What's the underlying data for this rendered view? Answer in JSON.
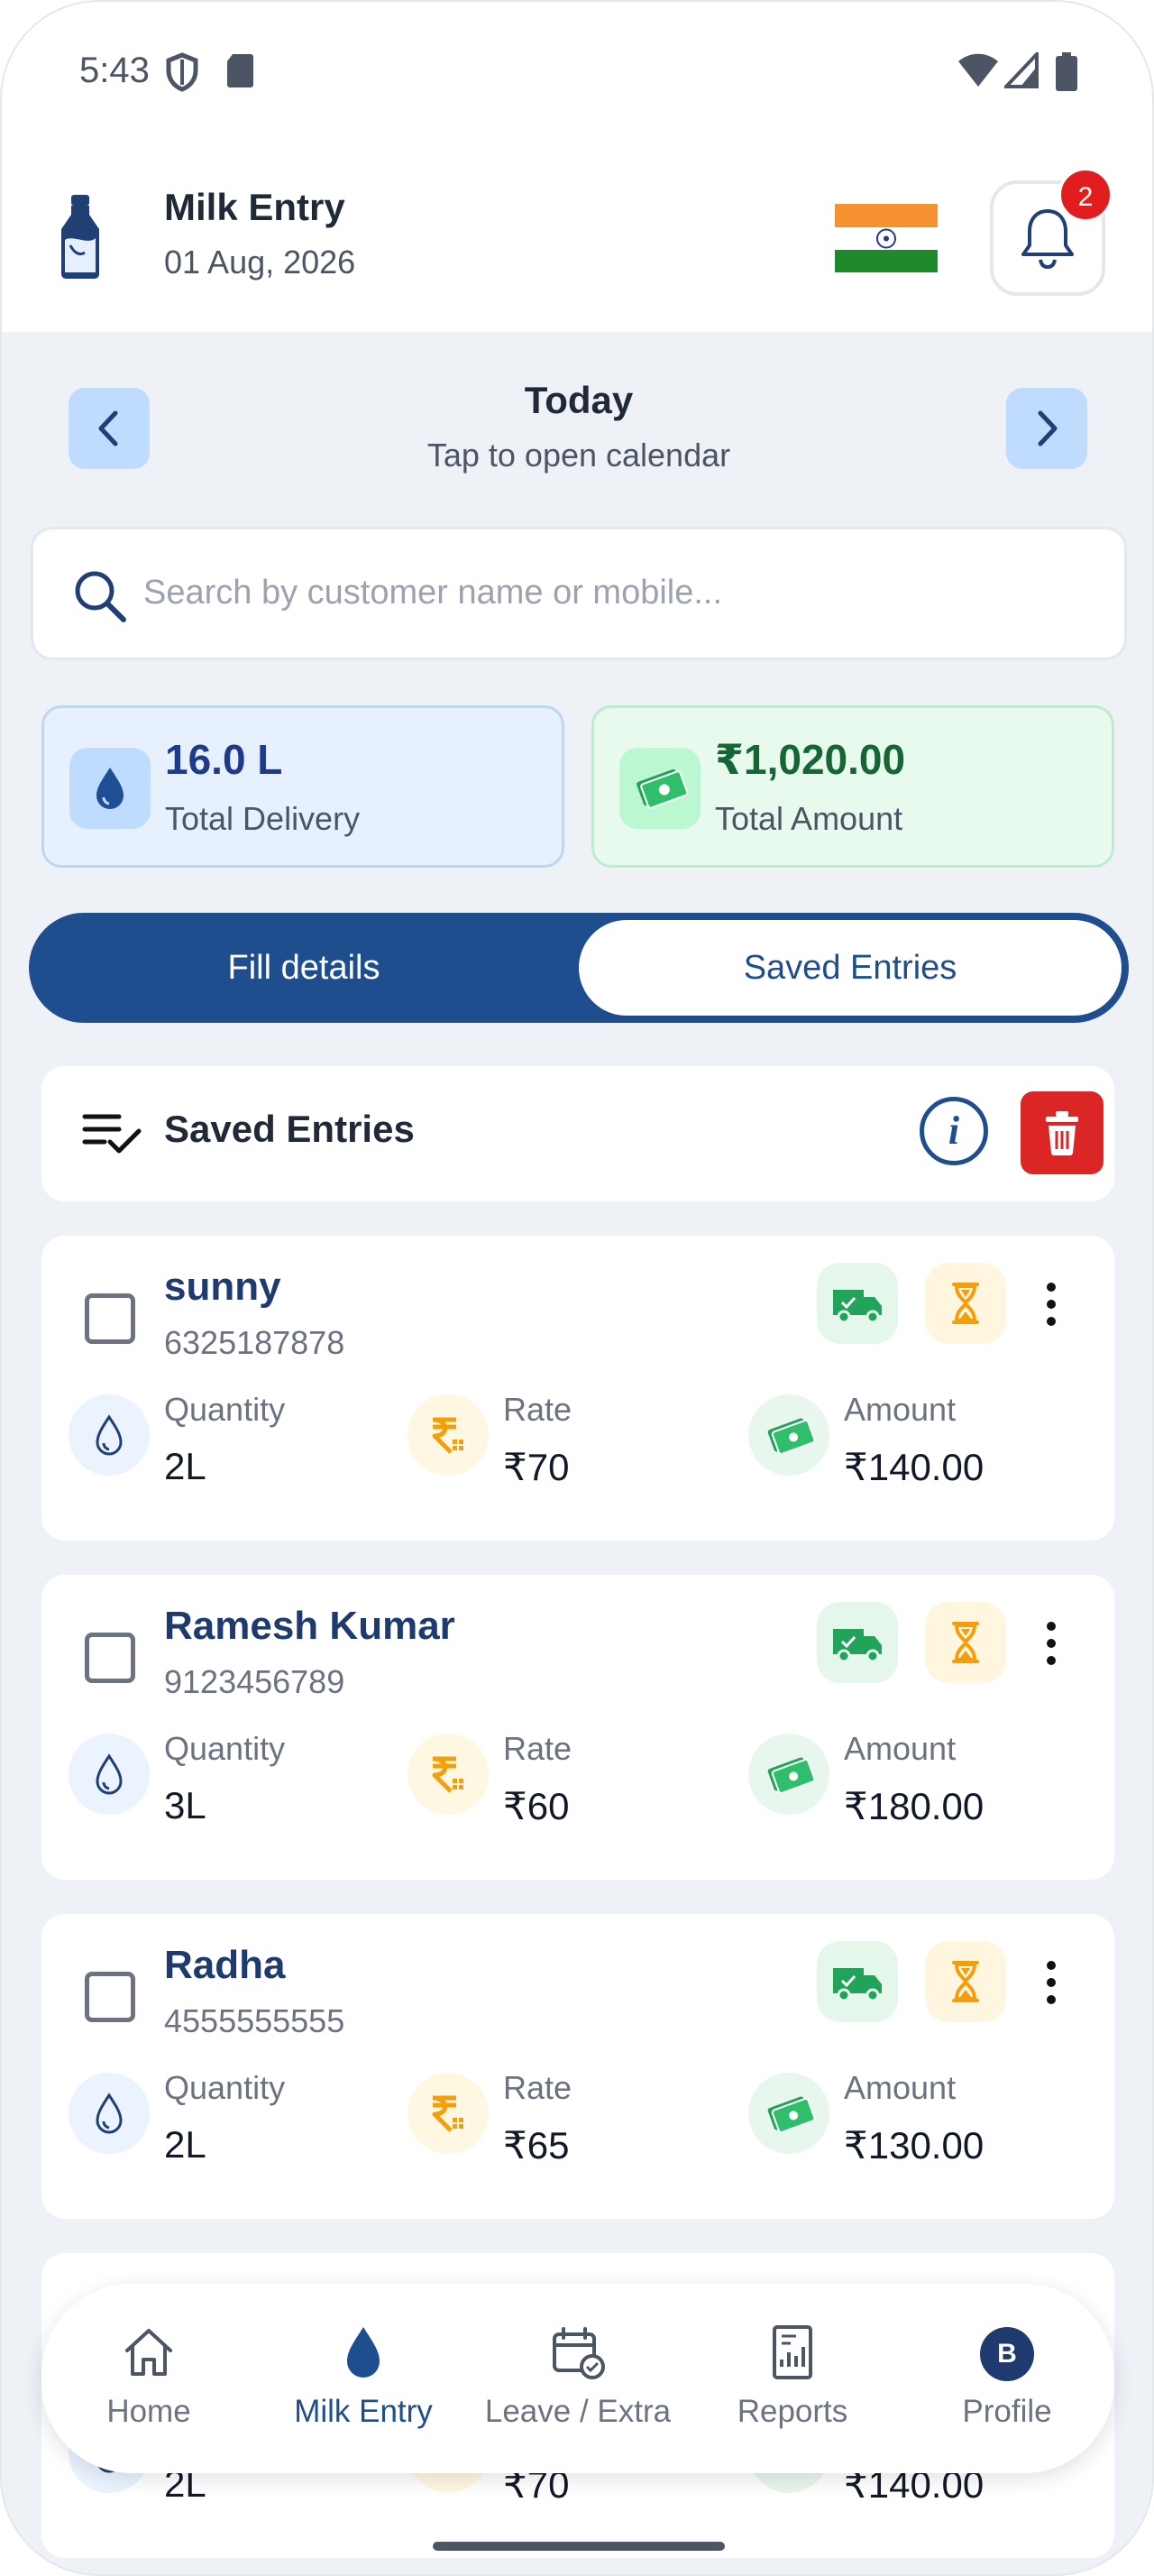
{
  "status_bar": {
    "time": "5:43"
  },
  "header": {
    "title": "Milk Entry",
    "date": "01 Aug, 2026",
    "notification_count": "2"
  },
  "date_nav": {
    "title": "Today",
    "subtitle": "Tap to open calendar"
  },
  "search": {
    "placeholder": "Search by customer name or mobile...",
    "value": ""
  },
  "stats": {
    "delivery_value": "16.0 L",
    "delivery_label": "Total Delivery",
    "amount_value": "₹1,020.00",
    "amount_label": "Total Amount"
  },
  "toggle": {
    "left": "Fill details",
    "right": "Saved Entries",
    "active": "right"
  },
  "saved_header": {
    "title": "Saved Entries"
  },
  "labels": {
    "quantity": "Quantity",
    "rate": "Rate",
    "amount": "Amount"
  },
  "entries": [
    {
      "name": "sunny",
      "mobile": "6325187878",
      "quantity": "2L",
      "rate": "₹70",
      "amount": "₹140.00"
    },
    {
      "name": "Ramesh Kumar",
      "mobile": "9123456789",
      "quantity": "3L",
      "rate": "₹60",
      "amount": "₹180.00"
    },
    {
      "name": "Radha",
      "mobile": "4555555555",
      "quantity": "2L",
      "rate": "₹65",
      "amount": "₹130.00"
    },
    {
      "name": "",
      "mobile": "",
      "quantity": "2L",
      "rate": "₹70",
      "amount": "₹140.00"
    }
  ],
  "bottom_nav": {
    "items": [
      {
        "label": "Home"
      },
      {
        "label": "Milk Entry"
      },
      {
        "label": "Leave / Extra"
      },
      {
        "label": "Reports"
      },
      {
        "label": "Profile"
      }
    ],
    "active": "Milk Entry",
    "avatar_initial": "B"
  },
  "colors": {
    "primary": "#1f4e8f",
    "danger": "#dc2626",
    "badge": "#e11d1d",
    "delivery_bg": "#e7f1fd",
    "amount_bg": "#e8faee",
    "background": "#eef2f7"
  },
  "icons": {
    "header": [
      "milk-bottle-icon",
      "india-flag-icon",
      "bell-icon"
    ],
    "entry": [
      "truck-icon",
      "hourglass-icon",
      "more-vertical-icon",
      "drop-icon",
      "rupee-icon",
      "cash-icon"
    ]
  }
}
